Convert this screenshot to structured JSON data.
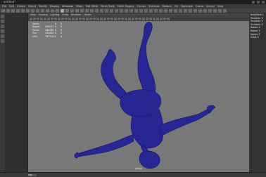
{
  "window": {
    "title": "- untitled*"
  },
  "menubar": {
    "items": [
      "File",
      "Edit",
      "Create",
      "Select",
      "Modify",
      "Display",
      "Windows",
      "Mesh",
      "Edit Mesh",
      "Mesh Tools",
      "Mesh Display",
      "Curves",
      "Surfaces",
      "Deform",
      "UV",
      "Generate",
      "Cache",
      "Arnold",
      "Help"
    ]
  },
  "panel": {
    "menu": [
      "View",
      "Shading",
      "Lighting",
      "Show",
      "Renderer",
      "Panels"
    ]
  },
  "hud": {
    "rows": [
      {
        "label": "Verts:",
        "value": "",
        "sel": "0",
        "extra": "0"
      },
      {
        "label": "Edges:",
        "value": "284071",
        "sel": "0",
        "extra": "0"
      },
      {
        "label": "Faces:",
        "value": "168381",
        "sel": "0",
        "extra": "0"
      },
      {
        "label": "Tris:",
        "value": "336662",
        "sel": "0",
        "extra": "0"
      },
      {
        "label": "UVs:",
        "value": "184203",
        "sel": "0",
        "extra": "0"
      }
    ]
  },
  "viewport": {
    "camera_label": "persp"
  },
  "channelbox": {
    "items": [
      "BodyMesh1",
      "Translate X",
      "Translate Y",
      "Translate Z",
      "Rotate X",
      "Rotate Y",
      "Rotate Z",
      "Scale X"
    ]
  },
  "status": {
    "command_label": "MEL"
  },
  "colors": {
    "viewport_bg": "#787878",
    "mesh": "#1f1f86",
    "mesh_wire": "#3a3ab8"
  },
  "icons": [
    "gear-icon",
    "select-tool-icon",
    "move-tool-icon",
    "rotate-tool-icon",
    "scale-tool-icon",
    "axis-gizmo-icon"
  ]
}
